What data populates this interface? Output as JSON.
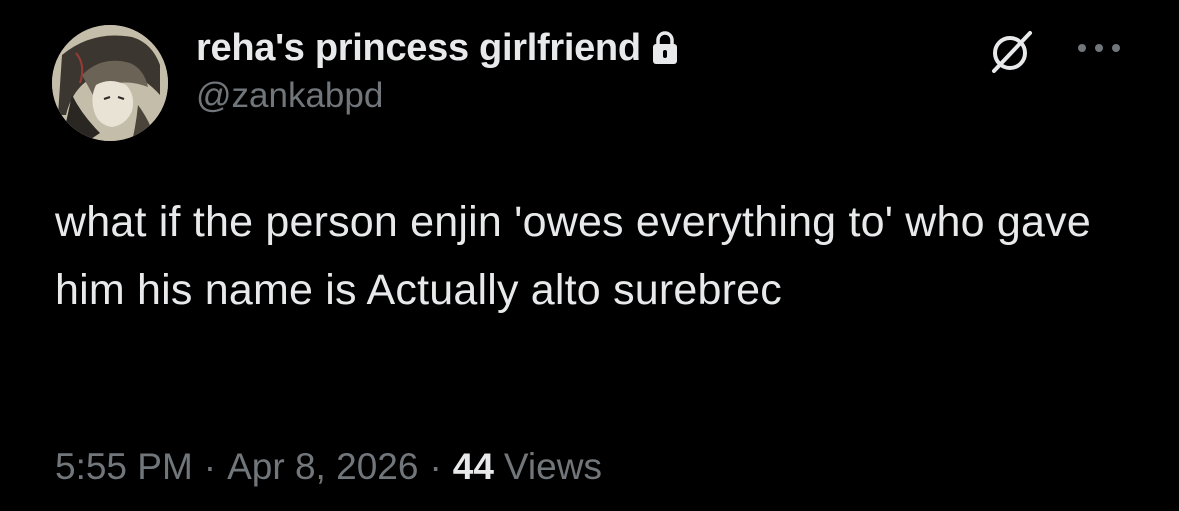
{
  "tweet": {
    "display_name": "reha's princess girlfriend",
    "handle": "@zankabpd",
    "text": "what if the person enjin 'owes everything to' who gave him his name is Actually alto surebrec",
    "time": "5:55 PM",
    "separator": "·",
    "date": "Apr 8, 2026",
    "views_count": "44",
    "views_label": "Views"
  },
  "icons": {
    "lock": "lock-icon",
    "grok": "grok-icon",
    "more": "more-icon"
  },
  "colors": {
    "background": "#000000",
    "primary_text": "#e7e9ea",
    "secondary_text": "#71767b"
  }
}
